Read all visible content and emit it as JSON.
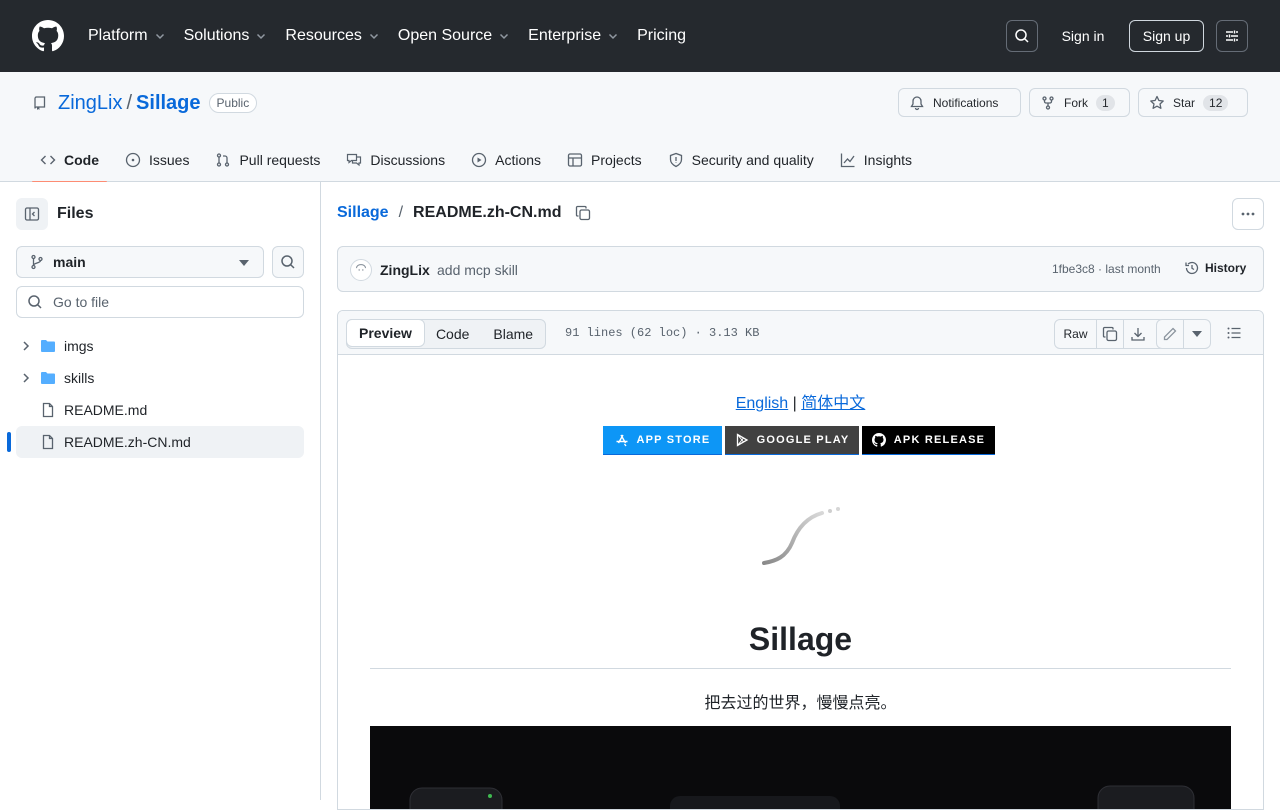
{
  "header": {
    "nav": [
      "Platform",
      "Solutions",
      "Resources",
      "Open Source",
      "Enterprise",
      "Pricing"
    ],
    "sign_in": "Sign in",
    "sign_up": "Sign up"
  },
  "repo": {
    "owner": "ZingLix",
    "name": "Sillage",
    "visibility": "Public",
    "notifications": "Notifications",
    "fork_label": "Fork",
    "fork_count": "1",
    "star_label": "Star",
    "star_count": "12",
    "tabs": [
      "Code",
      "Issues",
      "Pull requests",
      "Discussions",
      "Actions",
      "Projects",
      "Security and quality",
      "Insights"
    ]
  },
  "sidebar": {
    "title": "Files",
    "branch": "main",
    "goto_placeholder": "Go to file",
    "items": [
      {
        "label": "imgs",
        "type": "folder"
      },
      {
        "label": "skills",
        "type": "folder"
      },
      {
        "label": "README.md",
        "type": "file"
      },
      {
        "label": "README.zh-CN.md",
        "type": "file"
      }
    ]
  },
  "file": {
    "breadcrumb_repo": "Sillage",
    "breadcrumb_sep": "/",
    "name": "README.zh-CN.md",
    "commit_author": "ZingLix",
    "commit_message": "add mcp skill",
    "commit_sha": "1fbe3c8 · last month",
    "history": "History",
    "view_tabs": [
      "Preview",
      "Code",
      "Blame"
    ],
    "stats": "91 lines (62 loc) · 3.13 KB",
    "raw": "Raw"
  },
  "readme": {
    "lang_en": "English",
    "lang_sep": "|",
    "lang_zh": "简体中文",
    "badges": [
      {
        "label": "APP STORE",
        "color": "#0d96f6"
      },
      {
        "label": "GOOGLE PLAY",
        "color": "#414141"
      },
      {
        "label": "APK RELEASE",
        "color": "#000000"
      }
    ],
    "title": "Sillage",
    "tagline": "把去过的世界，慢慢点亮。"
  },
  "colors": {
    "header_bg": "#25292e",
    "link": "#0969da",
    "active_tab": "#fd8c73"
  }
}
